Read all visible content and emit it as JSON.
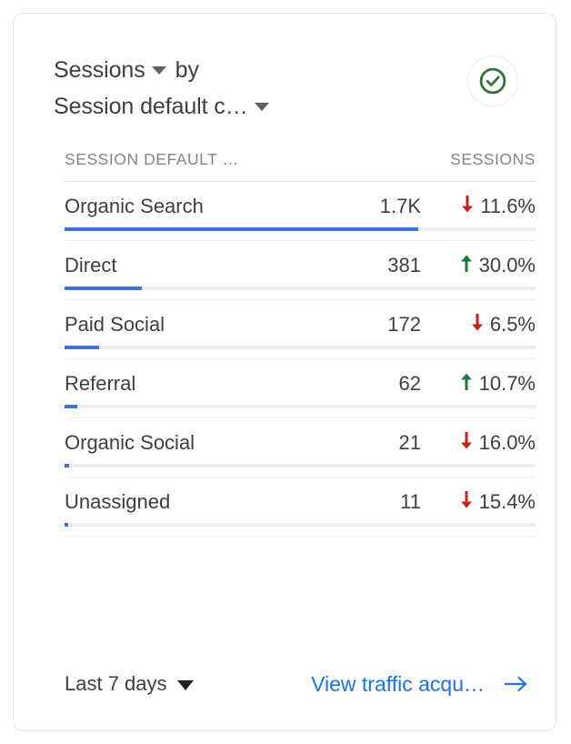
{
  "card": {
    "header": {
      "metric_label": "Sessions",
      "by_label": "by",
      "dimension_label": "Session default c…",
      "metric_caret_icon": "chevron-down-icon",
      "dimension_caret_icon": "chevron-down-icon",
      "status_icon": "check-circle-icon",
      "status_color": "#34723d"
    },
    "table": {
      "columns": {
        "dimension_header": "SESSION DEFAULT …",
        "value_header": "SESSIONS"
      },
      "bar_color": "#4071d9",
      "track_color": "#eceef0",
      "increase_color": "#1e7b34",
      "decrease_color": "#c5221f",
      "rows": [
        {
          "label": "Organic Search",
          "value": "1.7K",
          "delta": "11.6%",
          "direction": "down",
          "arrow_icon": "arrow-down-icon",
          "bar_percent": 75
        },
        {
          "label": "Direct",
          "value": "381",
          "delta": "30.0%",
          "direction": "up",
          "arrow_icon": "arrow-up-icon",
          "bar_percent": 16.4
        },
        {
          "label": "Paid Social",
          "value": "172",
          "delta": "6.5%",
          "direction": "down",
          "arrow_icon": "arrow-down-icon",
          "bar_percent": 7.4
        },
        {
          "label": "Referral",
          "value": "62",
          "delta": "10.7%",
          "direction": "up",
          "arrow_icon": "arrow-up-icon",
          "bar_percent": 2.7
        },
        {
          "label": "Organic Social",
          "value": "21",
          "delta": "16.0%",
          "direction": "down",
          "arrow_icon": "arrow-down-icon",
          "bar_percent": 0.95
        },
        {
          "label": "Unassigned",
          "value": "11",
          "delta": "15.4%",
          "direction": "down",
          "arrow_icon": "arrow-down-icon",
          "bar_percent": 0.75
        }
      ]
    },
    "footer": {
      "date_range_label": "Last 7 days",
      "date_caret_icon": "chevron-down-icon",
      "cta_label": "View traffic acqu…",
      "cta_arrow_icon": "arrow-right-icon",
      "cta_color": "#1a73e8"
    }
  },
  "chart_data": {
    "type": "bar",
    "title": "Sessions by Session default channel group",
    "xlabel": "",
    "ylabel": "Sessions",
    "categories": [
      "Organic Search",
      "Direct",
      "Paid Social",
      "Referral",
      "Organic Social",
      "Unassigned"
    ],
    "values": [
      1700,
      381,
      172,
      62,
      21,
      11
    ],
    "value_labels": [
      "1.7K",
      "381",
      "172",
      "62",
      "21",
      "11"
    ],
    "deltas": [
      -11.6,
      30.0,
      -6.5,
      10.7,
      -16.0,
      -15.4
    ],
    "delta_labels": [
      "11.6%",
      "30.0%",
      "6.5%",
      "10.7%",
      "16.0%",
      "15.4%"
    ],
    "bar_percents": [
      75,
      16.4,
      7.4,
      2.7,
      0.95,
      0.75
    ],
    "orientation": "horizontal",
    "grid": false,
    "legend": "none",
    "date_range": "Last 7 days"
  }
}
